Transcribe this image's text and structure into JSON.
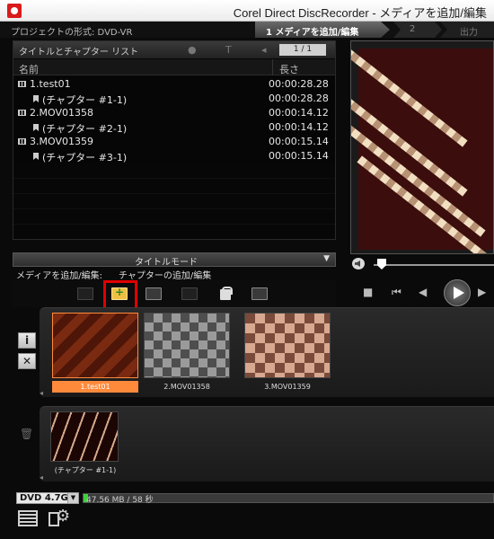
{
  "window": {
    "title": "Corel Direct DiscRecorder - メディアを追加/編集"
  },
  "project": {
    "format_label": "プロジェクトの形式: DVD-VR"
  },
  "steps": [
    {
      "label": "1 メディアを追加/編集"
    },
    {
      "label": "2"
    },
    {
      "label": "出力"
    }
  ],
  "list_panel": {
    "title": "タイトルとチャプター リスト",
    "page": "1 / 1",
    "columns": {
      "name": "名前",
      "length": "長さ"
    },
    "rows": [
      {
        "type": "title",
        "name": "1.test01",
        "duration": "00:00:28.28"
      },
      {
        "type": "chapter",
        "name": "(チャプター #1-1)",
        "duration": "00:00:28.28"
      },
      {
        "type": "title",
        "name": "2.MOV01358",
        "duration": "00:00:14.12"
      },
      {
        "type": "chapter",
        "name": "(チャプター #2-1)",
        "duration": "00:00:14.12"
      },
      {
        "type": "title",
        "name": "3.MOV01359",
        "duration": "00:00:15.14"
      },
      {
        "type": "chapter",
        "name": "(チャプター #3-1)",
        "duration": "00:00:15.14"
      }
    ]
  },
  "mode": {
    "label": "タイトルモード"
  },
  "edit": {
    "add_media_label": "メディアを追加/編集:",
    "add_chapter_label": "チャプターの追加/編集"
  },
  "titles_strip": {
    "thumbnails": [
      {
        "label": "1.test01",
        "selected": true
      },
      {
        "label": "2.MOV01358",
        "selected": false
      },
      {
        "label": "3.MOV01359",
        "selected": false
      }
    ],
    "side_buttons": {
      "info": "i",
      "delete": "✕"
    }
  },
  "chapters_strip": {
    "thumbnails": [
      {
        "label": "(チャプター #1-1)"
      }
    ]
  },
  "status": {
    "disc_type": "DVD 4.7G",
    "usage_text": "47.56 MB / 58 秒",
    "usage_fraction": 0.01
  },
  "colors": {
    "selected_accent": "#ff8a3c",
    "highlight_box": "#e10000",
    "usage_fill": "#3dd23d"
  }
}
